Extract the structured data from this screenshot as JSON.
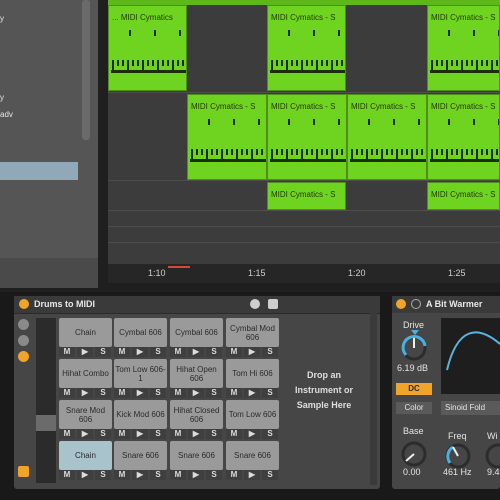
{
  "browser": {
    "items": [
      "y",
      "",
      "",
      "",
      "",
      "y",
      "adv"
    ]
  },
  "arrangement": {
    "clip_name": "MIDI Cymatics - S",
    "clip_name_short": "... MIDI Cymatics",
    "timeline": [
      "1:10",
      "1:15",
      "1:20",
      "1:25"
    ]
  },
  "drum_rack": {
    "title": "Drums to MIDI",
    "pads": [
      {
        "label": "Chain"
      },
      {
        "label": "Cymbal 606"
      },
      {
        "label": "Cymbal 606"
      },
      {
        "label": "Cymbal Mod 606"
      },
      {
        "label": "Hihat Combo"
      },
      {
        "label": "Tom Low 606-1"
      },
      {
        "label": "Hihat Open 606"
      },
      {
        "label": "Tom Hi 606"
      },
      {
        "label": "Snare Mod 606"
      },
      {
        "label": "Kick Mod 606"
      },
      {
        "label": "Hihat Closed 606"
      },
      {
        "label": "Tom Low 606"
      },
      {
        "label": "Chain"
      },
      {
        "label": "Snare 606"
      },
      {
        "label": "Snare 606"
      },
      {
        "label": "Snare 606"
      }
    ],
    "mute_label": "M",
    "play_label": "▶",
    "solo_label": "S",
    "drop_text": "Drop an Instrument or Sample Here"
  },
  "warmer": {
    "title": "A Bit Warmer",
    "drive_label": "Drive",
    "drive_value": "6.19 dB",
    "dc_label": "DC",
    "color_label": "Color",
    "fold_label": "Sinoid Fold",
    "base_label": "Base",
    "base_value": "0.00",
    "freq_label": "Freq",
    "freq_value": "461 Hz",
    "width_label": "Wi",
    "width_value": "9.4"
  },
  "colors": {
    "clip_green": "#6fd41f",
    "accent_orange": "#f0a52a",
    "selection_blue": "#a9c3cc"
  }
}
